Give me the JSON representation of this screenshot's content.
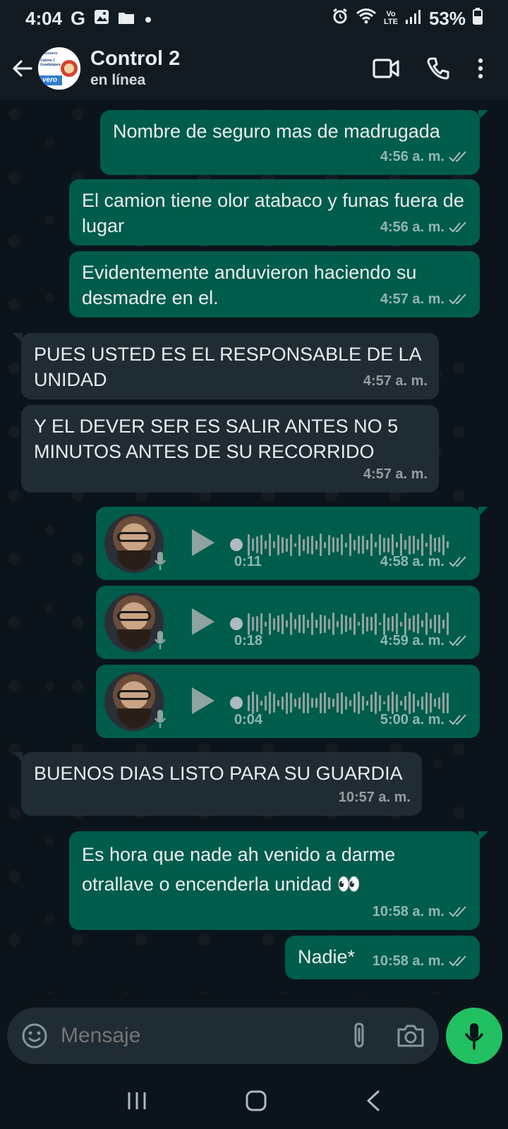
{
  "status_bar": {
    "time": "4:04",
    "left_icons": [
      "google-icon",
      "image-icon",
      "folder-icon",
      "dot-icon"
    ],
    "g_letter": "G",
    "battery": "53%",
    "right_icons": [
      "alarm-icon",
      "wifi-icon",
      "volte-icon",
      "signal-icon",
      "battery-icon"
    ],
    "volte_top": "Vo",
    "volte_bottom": "LTE"
  },
  "header": {
    "title": "Control 2",
    "subtitle": "en línea",
    "avatar_lines": [
      "Racionero",
      "Cabina 1",
      "Guadalajara",
      "vero"
    ]
  },
  "messages": [
    {
      "dir": "out",
      "text": "Nombre de seguro mas de madrugada",
      "time": "4:56 a. m."
    },
    {
      "dir": "out",
      "text": "El camion tiene olor atabaco y funas fuera de lugar",
      "time": "4:56 a. m."
    },
    {
      "dir": "out",
      "text": "Evidentemente anduvieron haciendo su desmadre en el.",
      "time": "4:57 a. m."
    },
    {
      "dir": "in",
      "text": "PUES USTED ES EL RESPONSABLE DE LA UNIDAD",
      "time": "4:57 a. m."
    },
    {
      "dir": "in",
      "text": "Y EL DEVER SER ES SALIR ANTES NO 5 MINUTOS ANTES DE SU RECORRIDO",
      "time": "4:57 a. m."
    },
    {
      "dir": "out",
      "type": "voice",
      "duration": "0:11",
      "time": "4:58 a. m."
    },
    {
      "dir": "out",
      "type": "voice",
      "duration": "0:18",
      "time": "4:59 a. m."
    },
    {
      "dir": "out",
      "type": "voice",
      "duration": "0:04",
      "time": "5:00 a. m."
    },
    {
      "dir": "in",
      "text": "BUENOS DIAS LISTO PARA SU GUARDIA",
      "time": "10:57 a. m."
    },
    {
      "dir": "out",
      "text": "Es hora que nade ah venido a darme otrallave o encenderla unidad",
      "emoji": "👀",
      "time": "10:58 a. m."
    },
    {
      "dir": "out",
      "text": "Nadie*",
      "time": "10:58 a. m."
    }
  ],
  "input": {
    "placeholder": "Mensaje"
  },
  "colors": {
    "background": "#0b141a",
    "bar": "#111b21",
    "outgoing_bubble": "#005c4b",
    "incoming_bubble": "#202c33",
    "accent": "#21c063",
    "read_ticks": "#aebac1"
  }
}
